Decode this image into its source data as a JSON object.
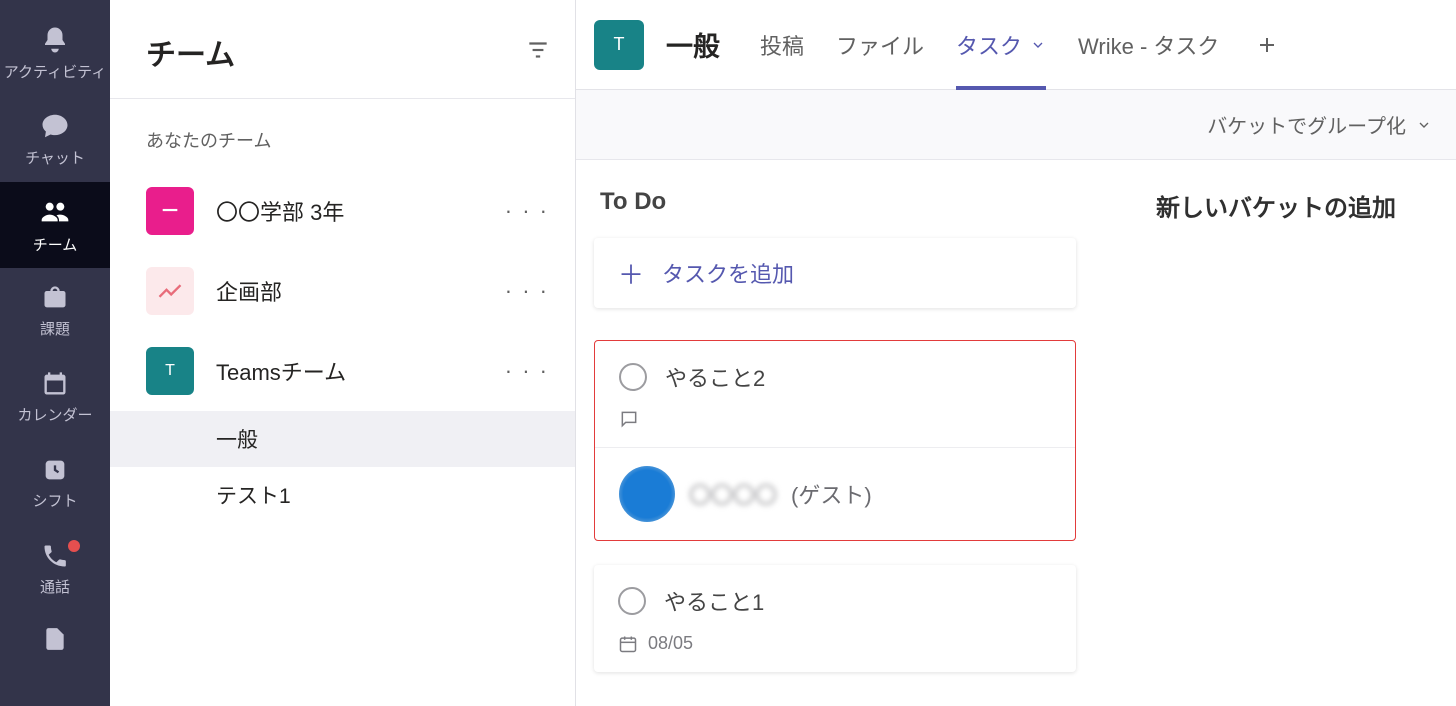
{
  "rail": {
    "activity": "アクティビティ",
    "chat": "チャット",
    "teams": "チーム",
    "assignments": "課題",
    "calendar": "カレンダー",
    "shifts": "シフト",
    "calls": "通話"
  },
  "sidebar": {
    "title": "チーム",
    "section_label": "あなたのチーム",
    "teams": [
      {
        "name": "〇〇学部 3年",
        "avatar_letter": "−",
        "avatar_class": "magenta"
      },
      {
        "name": "企画部",
        "avatar_letter": "",
        "avatar_class": "chart"
      },
      {
        "name": "Teamsチーム",
        "avatar_letter": "T",
        "avatar_class": "teal"
      }
    ],
    "channels": [
      {
        "name": "一般",
        "selected": true
      },
      {
        "name": "テスト1",
        "selected": false
      }
    ]
  },
  "header": {
    "avatar_letter": "T",
    "channel_name": "一般",
    "tabs": {
      "posts": "投稿",
      "files": "ファイル",
      "tasks": "タスク",
      "wrike": "Wrike - タスク"
    }
  },
  "toolbar": {
    "group_by": "バケットでグループ化"
  },
  "board": {
    "bucket_todo": "To Do",
    "add_bucket": "新しいバケットの追加",
    "add_task": "タスクを追加",
    "cards": [
      {
        "title": "やること2",
        "assignee_name": "〇〇〇〇",
        "assignee_guest": "(ゲスト)"
      },
      {
        "title": "やること1",
        "due": "08/05"
      }
    ]
  }
}
